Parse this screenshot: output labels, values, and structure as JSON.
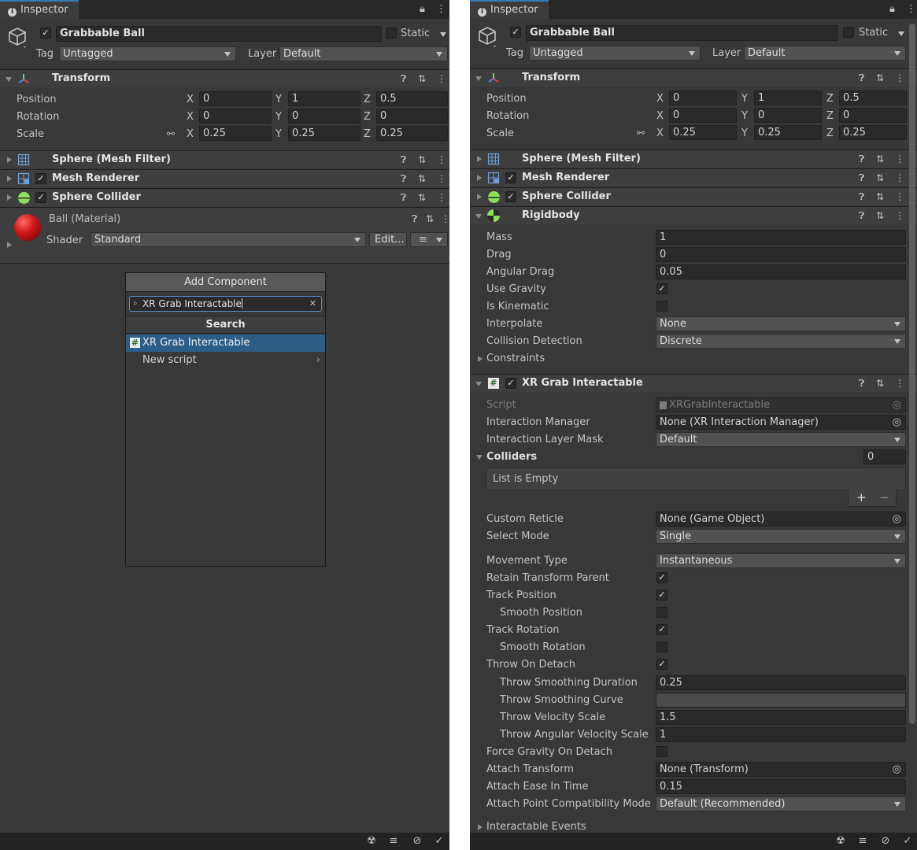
{
  "left": {
    "tab_label": "Inspector",
    "object_name": "Grabbable Ball",
    "static_label": "Static",
    "tag_label": "Tag",
    "tag_value": "Untagged",
    "layer_label": "Layer",
    "layer_value": "Default",
    "transform": {
      "title": "Transform",
      "position_label": "Position",
      "rotation_label": "Rotation",
      "scale_label": "Scale",
      "position": {
        "x": "0",
        "y": "1",
        "z": "0.5"
      },
      "rotation": {
        "x": "0",
        "y": "0",
        "z": "0"
      },
      "scale": {
        "x": "0.25",
        "y": "0.25",
        "z": "0.25"
      },
      "axis_x": "X",
      "axis_y": "Y",
      "axis_z": "Z"
    },
    "components": {
      "mesh_filter": "Sphere (Mesh Filter)",
      "mesh_renderer": "Mesh Renderer",
      "sphere_collider": "Sphere Collider"
    },
    "material": {
      "name": "Ball (Material)",
      "shader_label": "Shader",
      "shader_value": "Standard",
      "edit_label": "Edit..."
    },
    "add_component": {
      "button_label": "Add Component",
      "search_value": "XR Grab Interactable",
      "section_title": "Search",
      "result_selected": "XR Grab Interactable",
      "result_new_script": "New script"
    }
  },
  "right": {
    "tab_label": "Inspector",
    "object_name": "Grabbable Ball",
    "static_label": "Static",
    "tag_label": "Tag",
    "tag_value": "Untagged",
    "layer_label": "Layer",
    "layer_value": "Default",
    "transform": {
      "title": "Transform",
      "position_label": "Position",
      "rotation_label": "Rotation",
      "scale_label": "Scale",
      "position": {
        "x": "0",
        "y": "1",
        "z": "0.5"
      },
      "rotation": {
        "x": "0",
        "y": "0",
        "z": "0"
      },
      "scale": {
        "x": "0.25",
        "y": "0.25",
        "z": "0.25"
      },
      "axis_x": "X",
      "axis_y": "Y",
      "axis_z": "Z"
    },
    "components": {
      "mesh_filter": "Sphere (Mesh Filter)",
      "mesh_renderer": "Mesh Renderer",
      "sphere_collider": "Sphere Collider"
    },
    "rigidbody": {
      "title": "Rigidbody",
      "mass_label": "Mass",
      "mass_value": "1",
      "drag_label": "Drag",
      "drag_value": "0",
      "angular_drag_label": "Angular Drag",
      "angular_drag_value": "0.05",
      "use_gravity_label": "Use Gravity",
      "is_kinematic_label": "Is Kinematic",
      "interpolate_label": "Interpolate",
      "interpolate_value": "None",
      "collision_label": "Collision Detection",
      "collision_value": "Discrete",
      "constraints_label": "Constraints"
    },
    "xr": {
      "title": "XR Grab Interactable",
      "script_label": "Script",
      "script_value": "XRGrabInteractable",
      "interaction_manager_label": "Interaction Manager",
      "interaction_manager_value": "None (XR Interaction Manager)",
      "interaction_layer_label": "Interaction Layer Mask",
      "interaction_layer_value": "Default",
      "colliders_label": "Colliders",
      "colliders_count": "0",
      "list_empty": "List is Empty",
      "plus": "+",
      "minus": "−",
      "custom_reticle_label": "Custom Reticle",
      "custom_reticle_value": "None (Game Object)",
      "select_mode_label": "Select Mode",
      "select_mode_value": "Single",
      "movement_type_label": "Movement Type",
      "movement_type_value": "Instantaneous",
      "retain_transform_label": "Retain Transform Parent",
      "track_position_label": "Track Position",
      "smooth_position_label": "Smooth Position",
      "track_rotation_label": "Track Rotation",
      "smooth_rotation_label": "Smooth Rotation",
      "throw_on_detach_label": "Throw On Detach",
      "throw_smoothing_duration_label": "Throw Smoothing Duration",
      "throw_smoothing_duration_value": "0.25",
      "throw_smoothing_curve_label": "Throw Smoothing Curve",
      "throw_velocity_scale_label": "Throw Velocity Scale",
      "throw_velocity_scale_value": "1.5",
      "throw_angular_velocity_scale_label": "Throw Angular Velocity Scale",
      "throw_angular_velocity_scale_value": "1",
      "force_gravity_label": "Force Gravity On Detach",
      "attach_transform_label": "Attach Transform",
      "attach_transform_value": "None (Transform)",
      "attach_ease_label": "Attach Ease In Time",
      "attach_ease_value": "0.15",
      "attach_point_label": "Attach Point Compatibility Mode",
      "attach_point_value": "Default (Recommended)",
      "interactable_events_label": "Interactable Events"
    }
  },
  "colors": {
    "panel": "#383838",
    "accent": "#3a79bb",
    "selection": "#2c5d87"
  }
}
